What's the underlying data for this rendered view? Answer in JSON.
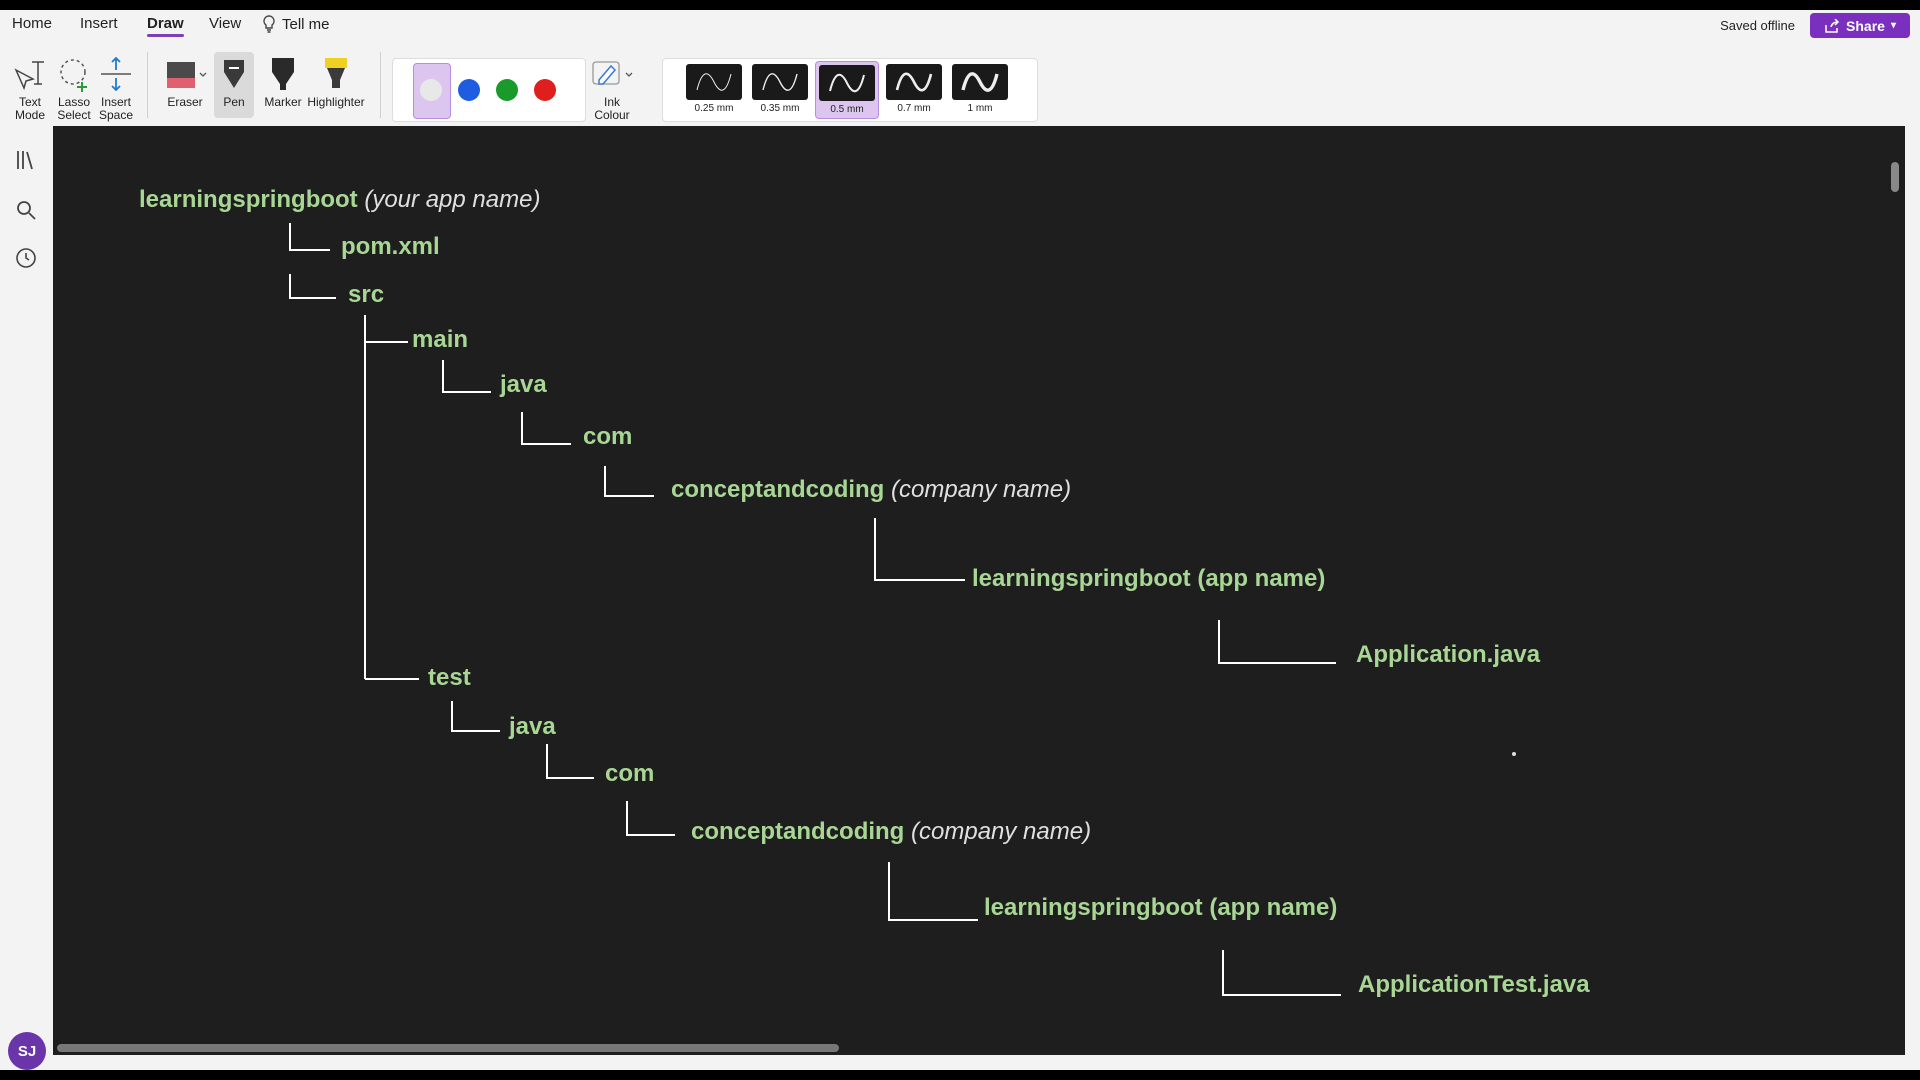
{
  "menu": {
    "items": [
      "Home",
      "Insert",
      "Draw",
      "View"
    ],
    "active": "Draw",
    "tell_me": "Tell me",
    "saved_status": "Saved offline",
    "share_label": "Share"
  },
  "ribbon": {
    "text_mode": [
      "Text",
      "Mode"
    ],
    "lasso_select": [
      "Lasso",
      "Select"
    ],
    "insert_space": [
      "Insert",
      "Space"
    ],
    "eraser": "Eraser",
    "pen": "Pen",
    "marker": "Marker",
    "highlighter": "Highlighter",
    "ink_colour": [
      "Ink",
      "Colour"
    ],
    "colors": [
      "#e8e8e8",
      "#1e5de0",
      "#1a9a2a",
      "#e01e1e"
    ],
    "thickness": [
      "0.25 mm",
      "0.35 mm",
      "0.5 mm",
      "0.7 mm",
      "1 mm"
    ],
    "selected_thickness": "0.5 mm"
  },
  "user": {
    "initials": "SJ"
  },
  "tree": {
    "root": {
      "name": "learningspringboot",
      "note": "(your app name)"
    },
    "pom": "pom.xml",
    "src": "src",
    "main": "main",
    "main_java": "java",
    "main_com": "com",
    "main_company": {
      "name": "conceptandcoding",
      "note": "(company name)"
    },
    "main_app": "learningspringboot (app name)",
    "main_file": "Application.java",
    "test": "test",
    "test_java": "java",
    "test_com": "com",
    "test_company": {
      "name": "conceptandcoding",
      "note": "(company name)"
    },
    "test_app": "learningspringboot (app name)",
    "test_file": "ApplicationTest.java"
  }
}
